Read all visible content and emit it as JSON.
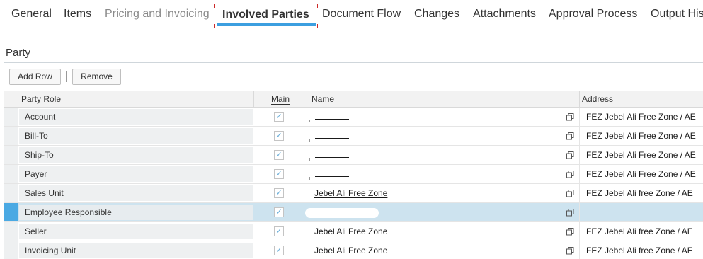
{
  "tabs": [
    {
      "label": "General",
      "state": "normal"
    },
    {
      "label": "Items",
      "state": "normal"
    },
    {
      "label": "Pricing and Invoicing",
      "state": "disabled"
    },
    {
      "label": "Involved Parties",
      "state": "active"
    },
    {
      "label": "Document Flow",
      "state": "normal"
    },
    {
      "label": "Changes",
      "state": "normal"
    },
    {
      "label": "Attachments",
      "state": "normal"
    },
    {
      "label": "Approval Process",
      "state": "normal"
    },
    {
      "label": "Output His",
      "state": "normal"
    }
  ],
  "section": {
    "title": "Party"
  },
  "toolbar": {
    "add_label": "Add Row",
    "remove_label": "Remove"
  },
  "table": {
    "headers": {
      "role": "Party Role",
      "main": "Main",
      "name": "Name",
      "address": "Address"
    },
    "rows": [
      {
        "role": "Account",
        "main": true,
        "name": "",
        "address": "FEZ Jebel Ali Free Zone / AE",
        "selected": false
      },
      {
        "role": "Bill-To",
        "main": true,
        "name": "",
        "address": "FEZ Jebel Ali Free Zone / AE",
        "selected": false
      },
      {
        "role": "Ship-To",
        "main": true,
        "name": "",
        "address": "FEZ Jebel Ali Free Zone / AE",
        "selected": false
      },
      {
        "role": "Payer",
        "main": true,
        "name": "",
        "address": "FEZ Jebel Ali Free Zone / AE",
        "selected": false
      },
      {
        "role": "Sales Unit",
        "main": true,
        "name": "Jebel Ali Free Zone",
        "address": "FEZ Jebel Ali free Zone / AE",
        "selected": false
      },
      {
        "role": "Employee Responsible",
        "main": true,
        "name": "",
        "address": "",
        "selected": true
      },
      {
        "role": "Seller",
        "main": true,
        "name": "Jebel Ali Free Zone",
        "address": "FEZ Jebel Ali free Zone / AE",
        "selected": false
      },
      {
        "role": "Invoicing Unit",
        "main": true,
        "name": "Jebel Ali Free Zone",
        "address": "FEZ Jebel Ali free Zone / AE",
        "selected": false
      }
    ]
  },
  "icons": {
    "checkbox": "checkmark-icon",
    "value_help": "copy-icon"
  },
  "colors": {
    "accent": "#3c9fe0",
    "selected_row": "#cde3ef",
    "selection_marker": "#4aa9e3"
  }
}
